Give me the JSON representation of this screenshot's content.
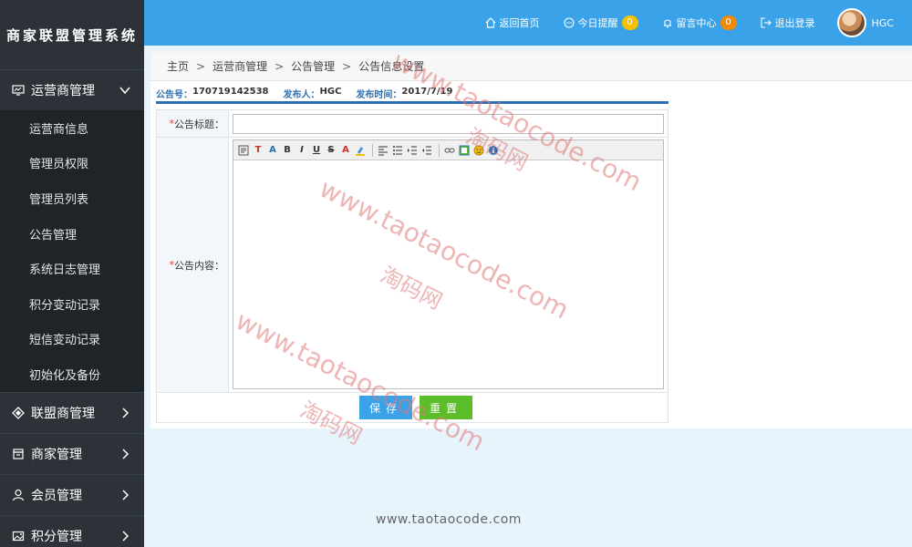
{
  "app": {
    "title": "商家联盟管理系统"
  },
  "sidebar": {
    "groups": [
      {
        "label": "运营商管理",
        "icon": "monitor-icon",
        "expanded": true,
        "items": [
          "运营商信息",
          "管理员权限",
          "管理员列表",
          "公告管理",
          "系统日志管理",
          "积分变动记录",
          "短信变动记录",
          "初始化及备份"
        ]
      },
      {
        "label": "联盟商管理",
        "icon": "diamond-icon",
        "expanded": false
      },
      {
        "label": "商家管理",
        "icon": "store-icon",
        "expanded": false
      },
      {
        "label": "会员管理",
        "icon": "user-icon",
        "expanded": false
      },
      {
        "label": "积分管理",
        "icon": "image-icon",
        "expanded": false
      }
    ]
  },
  "topbar": {
    "home_label": "返回首页",
    "reminder_label": "今日提醒",
    "reminder_count": "0",
    "message_label": "留言中心",
    "message_count": "0",
    "logout_label": "退出登录",
    "username": "HGC"
  },
  "breadcrumb": [
    "主页",
    "运营商管理",
    "公告管理",
    "公告信息设置"
  ],
  "notice": {
    "id_label": "公告号：",
    "id_value": "170719142538",
    "publisher_label": "发布人：",
    "publisher_value": "HGC",
    "time_label": "发布时间：",
    "time_value": "2017/7/19"
  },
  "form": {
    "title_label": "公告标题：",
    "title_value": "",
    "content_label": "公告内容：",
    "save_label": "保存",
    "reset_label": "重置"
  },
  "watermark": {
    "url": "www.taotaocode.com",
    "cn": "淘码网",
    "footer": "www.taotaocode.com"
  },
  "colors": {
    "topbar": "#3aa2e8",
    "sidebar": "#2d3238",
    "save_button": "#3aa2e8",
    "reset_button": "#5cbd2b",
    "accent_line": "#2c6fb3"
  }
}
